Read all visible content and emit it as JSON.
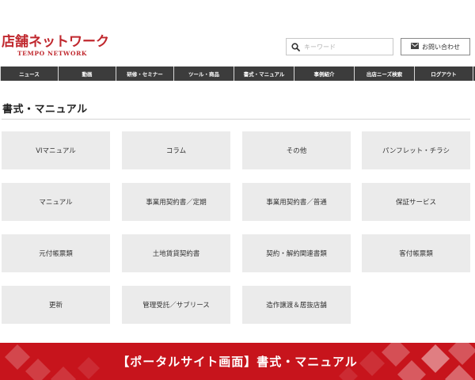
{
  "header": {
    "logo_main": "店舗ネットワーク",
    "logo_sub": "TEMPO NETWORK",
    "search_placeholder": "キーワード",
    "contact_label": "お問い合わせ"
  },
  "nav": {
    "items": [
      {
        "label": "ニュース"
      },
      {
        "label": "動画"
      },
      {
        "label": "研修・セミナー"
      },
      {
        "label": "ツール・商品"
      },
      {
        "label": "書式・マニュアル"
      },
      {
        "label": "事例紹介"
      },
      {
        "label": "出店ニーズ検索"
      },
      {
        "label": "ログアウト"
      }
    ]
  },
  "main": {
    "title": "書式・マニュアル",
    "tiles": [
      {
        "label": "VIマニュアル"
      },
      {
        "label": "コラム"
      },
      {
        "label": "その他"
      },
      {
        "label": "パンフレット・チラシ"
      },
      {
        "label": "マニュアル"
      },
      {
        "label": "事業用契約書／定期"
      },
      {
        "label": "事業用契約書／普通"
      },
      {
        "label": "保証サービス"
      },
      {
        "label": "元付帳票類"
      },
      {
        "label": "土地賃貸契約書"
      },
      {
        "label": "契約・解約関連書類"
      },
      {
        "label": "客付帳票類"
      },
      {
        "label": "更新"
      },
      {
        "label": "管理受託／サブリース"
      },
      {
        "label": "造作譲渡＆居抜店舗"
      }
    ]
  },
  "banner": {
    "text": "【ポータルサイト画面】書式・マニュアル"
  },
  "colors": {
    "brand_red": "#c0282e",
    "nav_bg": "#3c3c3c",
    "tile_bg": "#ebebeb",
    "banner_red": "#c7141c"
  },
  "icons": {
    "search": "magnifier-icon",
    "contact": "envelope-icon"
  }
}
